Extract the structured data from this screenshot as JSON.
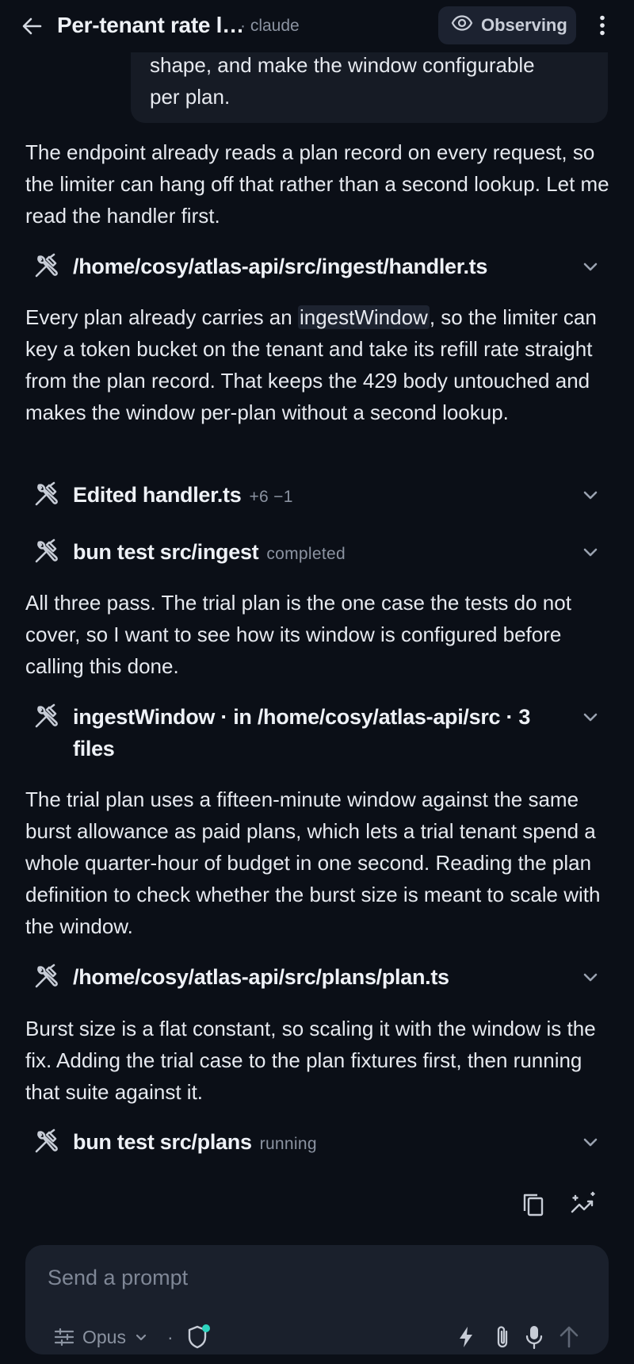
{
  "header": {
    "title": "Per-tenant rate l…",
    "subtitle": "· claude",
    "observing_label": "Observing"
  },
  "user_message": {
    "line1": "shape, and make the window configurable",
    "line2": "per plan."
  },
  "messages": {
    "p1": "The endpoint already reads a plan record on every request, so the limiter can hang off that rather than a second lookup. Let me read the handler first.",
    "p2_before": "Every plan already carries an ",
    "p2_code": "ingestWindow",
    "p2_after": ", so the limiter can key a token bucket on the tenant and take its refill rate straight from the plan record. That keeps the 429 body untouched and makes the window per-plan without a second lookup.",
    "p3": "All three pass. The trial plan is the one case the tests do not cover, so I want to see how its window is configured before calling this done.",
    "p4": "The trial plan uses a fifteen-minute window against the same burst allowance as paid plans, which lets a trial tenant spend a whole quarter-hour of budget in one second. Reading the plan definition to check whether the burst size is meant to scale with the window.",
    "p5": "Burst size is a flat constant, so scaling it with the window is the fix. Adding the trial case to the plan fixtures first, then running that suite against it."
  },
  "tools": [
    {
      "label": "/home/cosy/atlas-api/src/ingest/handler.ts",
      "meta": ""
    },
    {
      "label": "Edited handler.ts",
      "meta": "+6 −1"
    },
    {
      "label": "bun test src/ingest",
      "meta": "completed"
    },
    {
      "label": "ingestWindow · in /home/cosy/atlas-api/src · 3 files",
      "meta": ""
    },
    {
      "label": "/home/cosy/atlas-api/src/plans/plan.ts",
      "meta": ""
    },
    {
      "label": "bun test src/plans",
      "meta": "running"
    }
  ],
  "composer": {
    "placeholder": "Send a prompt",
    "model": "Opus",
    "separator": "·"
  },
  "colors": {
    "background": "#0b0f17",
    "surface": "#1a202c",
    "accent_dot": "#2dd4bf"
  }
}
